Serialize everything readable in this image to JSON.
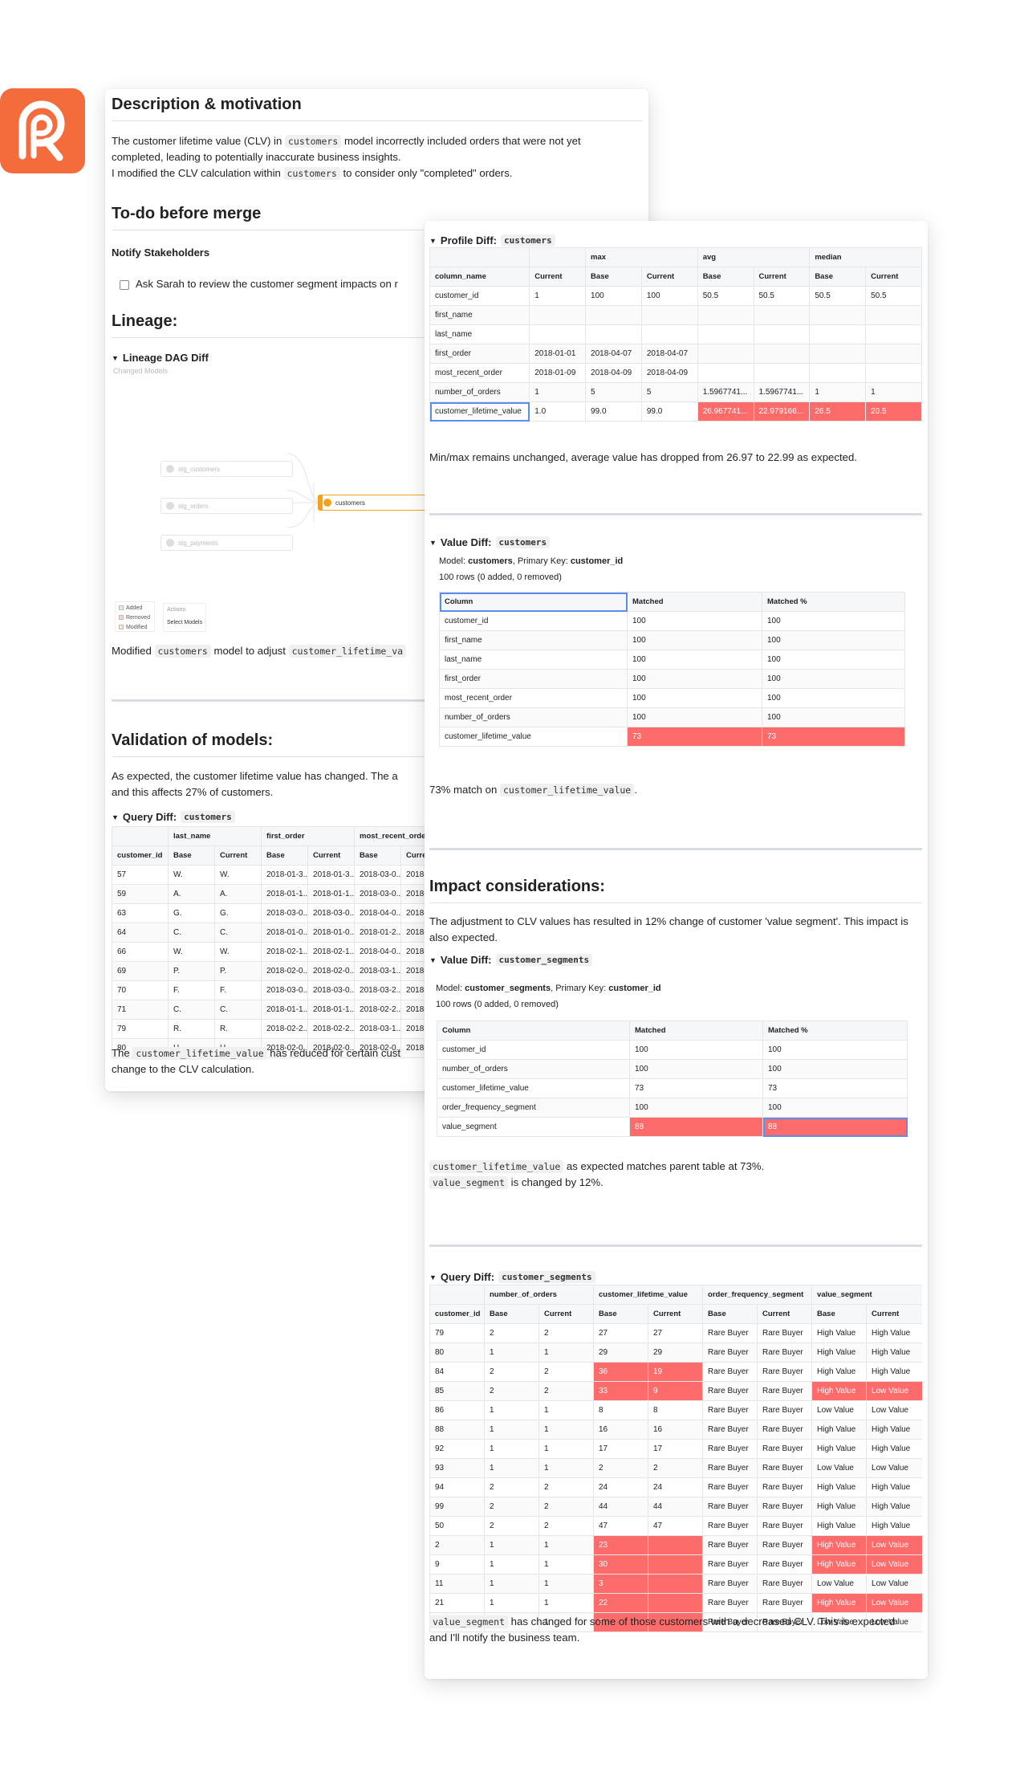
{
  "colors": {
    "brand": "#f46b3c",
    "diff_red": "#fd6b6b",
    "dag_accent": "#f3a21a"
  },
  "cardA": {
    "description": {
      "title": "Description & motivation",
      "l1a": "The customer lifetime value (CLV) in ",
      "l1code": "customers",
      "l1b": " model incorrectly included orders that were not yet",
      "l2": "completed, leading to potentially inaccurate business insights.",
      "l3a": "I modified the CLV calculation within ",
      "l3code": "customers",
      "l3b": " to consider only \"completed\" orders."
    },
    "todo": {
      "title": "To-do before merge",
      "subtitle": "Notify Stakeholders",
      "item": "Ask Sarah to review the customer segment impacts on r"
    },
    "lineage": {
      "title": "Lineage:",
      "section": "Lineage DAG Diff",
      "changed": "Changed Models",
      "nodes": {
        "stg_customers": "stg_customers",
        "stg_orders": "stg_orders",
        "stg_payments": "stg_payments",
        "customers": "customers"
      },
      "legend": {
        "added": "Added",
        "removed": "Removed",
        "modified": "Modified",
        "actions": "Actions",
        "select": "Select Models"
      },
      "caption_a": "Modified ",
      "caption_code1": "customers",
      "caption_b": " model to adjust ",
      "caption_code2": "customer_lifetime_va"
    },
    "validation": {
      "title": "Validation of models:",
      "l1": "As expected, the customer lifetime value has changed. The a",
      "l2": "and this affects 27% of customers.",
      "qd_label": "Query Diff:",
      "qd_code": "customers",
      "header_groups": [
        "last_name",
        "first_order",
        "most_recent_order"
      ],
      "header": [
        "customer_id",
        "Base",
        "Current",
        "Base",
        "Current",
        "Base",
        "Curre"
      ],
      "rows": [
        [
          "57",
          "W.",
          "W.",
          "2018-01-3...",
          "2018-01-3...",
          "2018-03-0...",
          "2018-"
        ],
        [
          "59",
          "A.",
          "A.",
          "2018-01-1...",
          "2018-01-1...",
          "2018-03-0...",
          "2018-"
        ],
        [
          "63",
          "G.",
          "G.",
          "2018-03-0...",
          "2018-03-0...",
          "2018-04-0...",
          "2018-"
        ],
        [
          "64",
          "C.",
          "C.",
          "2018-01-0...",
          "2018-01-0...",
          "2018-01-2...",
          "2018-"
        ],
        [
          "66",
          "W.",
          "W.",
          "2018-02-1...",
          "2018-02-1...",
          "2018-04-0...",
          "2018-"
        ],
        [
          "69",
          "P.",
          "P.",
          "2018-02-0...",
          "2018-02-0...",
          "2018-03-1...",
          "2018-"
        ],
        [
          "70",
          "F.",
          "F.",
          "2018-03-0...",
          "2018-03-0...",
          "2018-03-2...",
          "2018-"
        ],
        [
          "71",
          "C.",
          "C.",
          "2018-01-1...",
          "2018-01-1...",
          "2018-02-2...",
          "2018-"
        ],
        [
          "79",
          "R.",
          "R.",
          "2018-02-2...",
          "2018-02-2...",
          "2018-03-1...",
          "2018-"
        ],
        [
          "80",
          "H.",
          "H.",
          "2018-02-0...",
          "2018-02-0...",
          "2018-02-0...",
          "2018-"
        ]
      ],
      "foot_a": "The ",
      "foot_code": "customer_lifetime_value",
      "foot_b": " has reduced for certain cust",
      "foot_l2": "change to the CLV calculation."
    }
  },
  "cardB": {
    "profile": {
      "label": "Profile Diff:",
      "code": "customers",
      "header_groups": [
        "max",
        "avg",
        "median"
      ],
      "header": [
        "column_name",
        "Current",
        "Base",
        "Current",
        "Base",
        "Current",
        "Base",
        "Current"
      ],
      "rows": [
        [
          "customer_id",
          "1",
          "100",
          "100",
          "50.5",
          "50.5",
          "50.5",
          "50.5"
        ],
        [
          "first_name",
          "",
          "",
          "",
          "",
          "",
          "",
          ""
        ],
        [
          "last_name",
          "",
          "",
          "",
          "",
          "",
          "",
          ""
        ],
        [
          "first_order",
          "2018-01-01",
          "2018-04-07",
          "2018-04-07",
          "",
          "",
          "",
          ""
        ],
        [
          "most_recent_order",
          "2018-01-09",
          "2018-04-09",
          "2018-04-09",
          "",
          "",
          "",
          ""
        ],
        [
          "number_of_orders",
          "1",
          "5",
          "5",
          "1.5967741...",
          "1.5967741...",
          "1",
          "1"
        ],
        [
          "customer_lifetime_value",
          "1.0",
          "99.0",
          "99.0",
          "26.967741...",
          "22.979166...",
          "26.5",
          "20.5"
        ]
      ],
      "note": "Min/max remains unchanged, average value has dropped from 26.97 to 22.99 as expected."
    },
    "value_diff1": {
      "label": "Value Diff:",
      "code": "customers",
      "model_prefix": "Model: ",
      "model": "customers",
      "pk_prefix": ", Primary Key: ",
      "pk": "customer_id",
      "rows_info": "100 rows (0 added, 0 removed)",
      "header": [
        "Column",
        "Matched",
        "Matched %"
      ],
      "rows": [
        [
          "customer_id",
          "100",
          "100"
        ],
        [
          "first_name",
          "100",
          "100"
        ],
        [
          "last_name",
          "100",
          "100"
        ],
        [
          "first_order",
          "100",
          "100"
        ],
        [
          "most_recent_order",
          "100",
          "100"
        ],
        [
          "number_of_orders",
          "100",
          "100"
        ],
        [
          "customer_lifetime_value",
          "73",
          "73"
        ]
      ],
      "note_a": "73% match on ",
      "note_code": "customer_lifetime_value",
      "note_b": "."
    },
    "impact": {
      "title": "Impact considerations:",
      "l1": "The adjustment to CLV values has resulted in 12% change of customer 'value segment'. This impact is",
      "l2": "also expected."
    },
    "value_diff2": {
      "label": "Value Diff:",
      "code": "customer_segments",
      "model_prefix": "Model: ",
      "model": "customer_segments",
      "pk_prefix": ", Primary Key: ",
      "pk": "customer_id",
      "rows_info": "100 rows (0 added, 0 removed)",
      "header": [
        "Column",
        "Matched",
        "Matched %"
      ],
      "rows": [
        [
          "customer_id",
          "100",
          "100"
        ],
        [
          "number_of_orders",
          "100",
          "100"
        ],
        [
          "customer_lifetime_value",
          "73",
          "73"
        ],
        [
          "order_frequency_segment",
          "100",
          "100"
        ],
        [
          "value_segment",
          "88",
          "88"
        ]
      ],
      "note1_code": "customer_lifetime_value",
      "note1_b": " as expected matches parent table at 73%.",
      "note2_code": "value_segment",
      "note2_b": " is changed by 12%."
    },
    "query_diff": {
      "label": "Query Diff:",
      "code": "customer_segments",
      "header_groups": [
        "number_of_orders",
        "customer_lifetime_value",
        "order_frequency_segment",
        "value_segment"
      ],
      "header": [
        "customer_id",
        "Base",
        "Current",
        "Base",
        "Current",
        "Base",
        "Current",
        "Base",
        "Current"
      ],
      "rows": [
        [
          "79",
          "2",
          "2",
          "27",
          "27",
          "Rare Buyer",
          "Rare Buyer",
          "High Value",
          "High Value"
        ],
        [
          "80",
          "1",
          "1",
          "29",
          "29",
          "Rare Buyer",
          "Rare Buyer",
          "High Value",
          "High Value"
        ],
        [
          "84",
          "2",
          "2",
          "36",
          "19",
          "Rare Buyer",
          "Rare Buyer",
          "High Value",
          "High Value"
        ],
        [
          "85",
          "2",
          "2",
          "33",
          "9",
          "Rare Buyer",
          "Rare Buyer",
          "High Value",
          "Low Value"
        ],
        [
          "86",
          "1",
          "1",
          "8",
          "8",
          "Rare Buyer",
          "Rare Buyer",
          "Low Value",
          "Low Value"
        ],
        [
          "88",
          "1",
          "1",
          "16",
          "16",
          "Rare Buyer",
          "Rare Buyer",
          "High Value",
          "High Value"
        ],
        [
          "92",
          "1",
          "1",
          "17",
          "17",
          "Rare Buyer",
          "Rare Buyer",
          "High Value",
          "High Value"
        ],
        [
          "93",
          "1",
          "1",
          "2",
          "2",
          "Rare Buyer",
          "Rare Buyer",
          "Low Value",
          "Low Value"
        ],
        [
          "94",
          "2",
          "2",
          "24",
          "24",
          "Rare Buyer",
          "Rare Buyer",
          "High Value",
          "High Value"
        ],
        [
          "99",
          "2",
          "2",
          "44",
          "44",
          "Rare Buyer",
          "Rare Buyer",
          "High Value",
          "High Value"
        ],
        [
          "50",
          "2",
          "2",
          "47",
          "47",
          "Rare Buyer",
          "Rare Buyer",
          "High Value",
          "High Value"
        ],
        [
          "2",
          "1",
          "1",
          "23",
          "",
          "Rare Buyer",
          "Rare Buyer",
          "High Value",
          "Low Value"
        ],
        [
          "9",
          "1",
          "1",
          "30",
          "",
          "Rare Buyer",
          "Rare Buyer",
          "High Value",
          "Low Value"
        ],
        [
          "11",
          "1",
          "1",
          "3",
          "",
          "Rare Buyer",
          "Rare Buyer",
          "Low Value",
          "Low Value"
        ],
        [
          "21",
          "1",
          "1",
          "22",
          "",
          "Rare Buyer",
          "Rare Buyer",
          "High Value",
          "Low Value"
        ],
        [
          "40",
          "1",
          "1",
          "3",
          "",
          "Rare Buyer",
          "Rare Buyer",
          "Low Value",
          "Low Value"
        ]
      ],
      "red_cells": [
        [
          2,
          3
        ],
        [
          2,
          4
        ],
        [
          3,
          3
        ],
        [
          3,
          4
        ],
        [
          3,
          7
        ],
        [
          3,
          8
        ],
        [
          11,
          3
        ],
        [
          11,
          4
        ],
        [
          11,
          7
        ],
        [
          11,
          8
        ],
        [
          12,
          3
        ],
        [
          12,
          4
        ],
        [
          12,
          7
        ],
        [
          12,
          8
        ],
        [
          13,
          3
        ],
        [
          13,
          4
        ],
        [
          14,
          3
        ],
        [
          14,
          4
        ],
        [
          14,
          7
        ],
        [
          14,
          8
        ],
        [
          15,
          3
        ],
        [
          15,
          4
        ]
      ],
      "note_code": "value_segment",
      "note_b": " has changed for some of those customers with a decreased CLV. This is expected",
      "note_l2": "and I'll notify the business team."
    }
  }
}
